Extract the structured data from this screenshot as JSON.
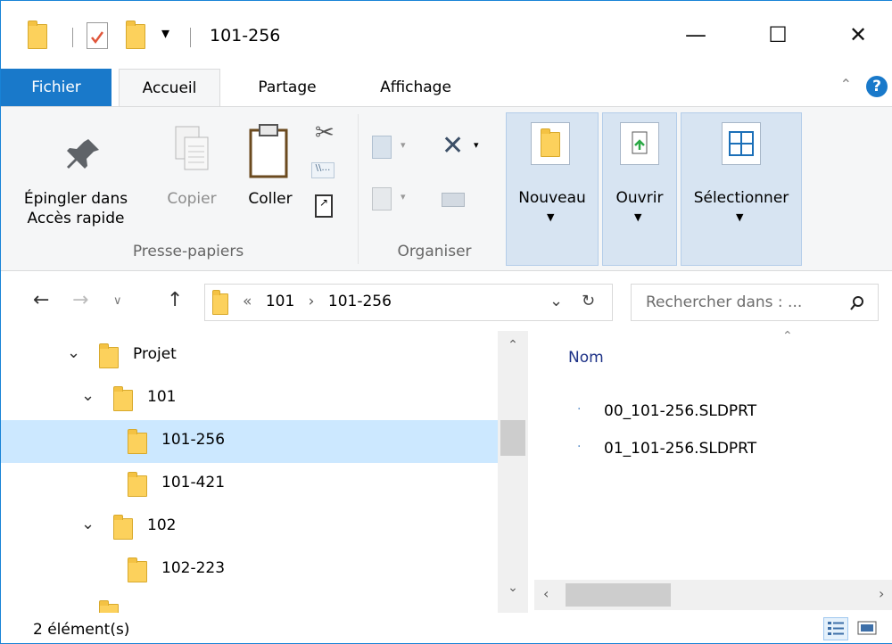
{
  "window": {
    "title": "101-256",
    "controls": {
      "minimize": "—",
      "maximize": "☐",
      "close": "✕"
    },
    "qat_dropdown": "▾"
  },
  "tabs": [
    {
      "label": "Fichier"
    },
    {
      "label": "Accueil"
    },
    {
      "label": "Partage"
    },
    {
      "label": "Affichage"
    }
  ],
  "ribbon": {
    "pin": {
      "label_1": "Épingler dans",
      "label_2": "Accès rapide"
    },
    "copy": {
      "label": "Copier"
    },
    "paste": {
      "label": "Coller"
    },
    "groups": {
      "clipboard": "Presse-papiers",
      "organize": "Organiser"
    },
    "new": {
      "label": "Nouveau"
    },
    "open": {
      "label": "Ouvrir"
    },
    "select": {
      "label": "Sélectionner"
    }
  },
  "nav": {
    "path_prefix": "«",
    "crumbs": [
      "101",
      "101-256"
    ],
    "crumb_sep": "›",
    "search_placeholder": "Rechercher dans : ..."
  },
  "tree": [
    {
      "label": "Projet",
      "expanded": true
    },
    {
      "label": "101",
      "expanded": true
    },
    {
      "label": "101-256",
      "selected": true
    },
    {
      "label": "101-421"
    },
    {
      "label": "102",
      "expanded": true
    },
    {
      "label": "102-223"
    }
  ],
  "content": {
    "column_name": "Nom",
    "files": [
      "00_101-256.SLDPRT",
      "01_101-256.SLDPRT"
    ]
  },
  "status": {
    "count": "2 élément(s)"
  },
  "colors": {
    "accent": "#1979ca",
    "selection": "#cce8ff",
    "folder": "#fcd15c",
    "ribbon_bg": "#f5f6f7"
  }
}
